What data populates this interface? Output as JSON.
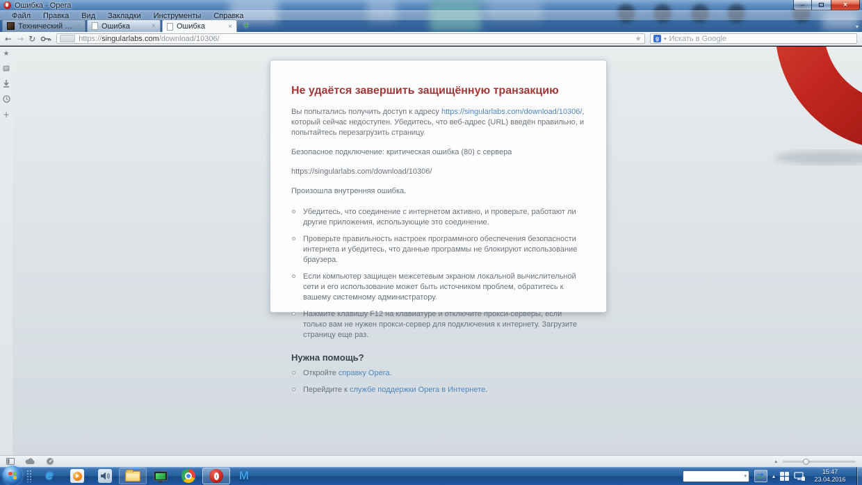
{
  "window": {
    "title": "Ошибка - Opera"
  },
  "icons": {
    "back": "←",
    "forward": "→",
    "reload": "↻",
    "bookmark_star": "★",
    "new_tab": "+",
    "close_tab": "×",
    "dropdown": "▾",
    "tray_expand": "▴",
    "minimize": "–",
    "close_window": "×",
    "slider_arrow": "▴",
    "google_letter": "g",
    "ie_letter": "e",
    "malwarebytes_letter": "M",
    "sidebar_star": "★",
    "sidebar_plus": "+",
    "tab_overflow": "▾"
  },
  "menu": {
    "items": [
      "Файл",
      "Правка",
      "Вид",
      "Закладки",
      "Инструменты",
      "Справка"
    ]
  },
  "tab_bar": {
    "tabs": [
      {
        "title": "Технический форум - ..."
      },
      {
        "title": "Ошибка"
      },
      {
        "title": "Ошибка"
      }
    ]
  },
  "address_bar": {
    "url": {
      "scheme": "https://",
      "host": "singularlabs.com",
      "path": "/download/10306/"
    },
    "search_placeholder": "Искать в Google"
  },
  "error_page": {
    "title": "Не удаётся завершить защищённую транзакцию",
    "intro": {
      "pre": "Вы попытались получить доступ к адресу ",
      "link": "https://singularlabs.com/download/10306/",
      "post": ", который сейчас недоступен. Убедитесь, что веб-адрес (URL) введён правильно, и попытайтесь перезагрузить страницу."
    },
    "error_line": "Безопасное подключение: критическая ошибка (80) с сервера",
    "url_line": "https://singularlabs.com/download/10306/",
    "internal_error_line": "Произошла внутренняя ошибка.",
    "suggestions": [
      "Убедитесь, что соединение с интернетом активно, и проверьте, работают ли другие приложения, использующие это соединение.",
      "Проверьте правильность настроек программного обеспечения безопасности интернета и убедитесь, что данные программы не блокируют использование браузера.",
      "Если компьютер защищен межсетевым экраном локальной вычислительной сети и его использование может быть источником проблем, обратитесь к вашему системному администратору.",
      "Нажмите клавишу F12 на клавиатуре и отключите прокси-серверы, если только вам не нужен прокси-сервер для подключения к интернету. Загрузите страницу еще раз."
    ],
    "help": {
      "title": "Нужна помощь?",
      "items": [
        {
          "pre": "Откройте ",
          "link": "справку Opera",
          "post": "."
        },
        {
          "pre": "Перейдите к ",
          "link": "службе поддержки Opera в Интернете",
          "post": "."
        }
      ]
    }
  },
  "taskbar": {
    "clock": {
      "time": "15:47",
      "date": "23.04.2016"
    }
  },
  "colors": {
    "error_title_red": "#a23737",
    "link_blue": "#4f86bd",
    "opera_red": "#c0261f",
    "taskbar_blue": "#2e6cb5"
  }
}
